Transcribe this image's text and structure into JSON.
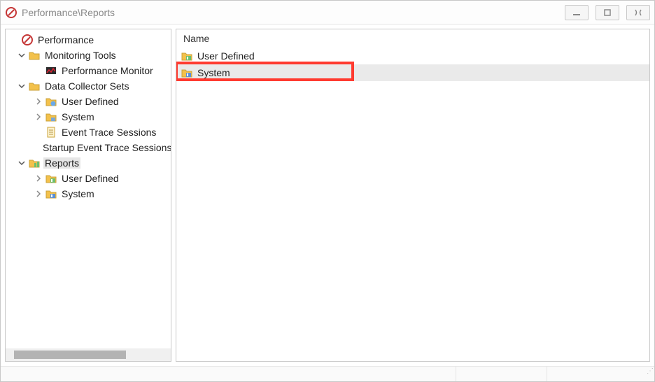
{
  "title": "Performance\\Reports",
  "tree": {
    "root_label": "Performance",
    "monitoring_tools": "Monitoring Tools",
    "perf_monitor": "Performance Monitor",
    "dcs": "Data Collector Sets",
    "dcs_user_defined": "User Defined",
    "dcs_system": "System",
    "dcs_ets": "Event Trace Sessions",
    "dcs_startup_ets": "Startup Event Trace Sessions",
    "reports": "Reports",
    "reports_user_defined": "User Defined",
    "reports_system": "System"
  },
  "list": {
    "column_name": "Name",
    "items": [
      {
        "label": "User Defined",
        "icon": "report-folder-green"
      },
      {
        "label": "System",
        "icon": "report-folder-blue"
      }
    ],
    "selected_index": 1
  },
  "colors": {
    "highlight": "#ff3b30"
  }
}
